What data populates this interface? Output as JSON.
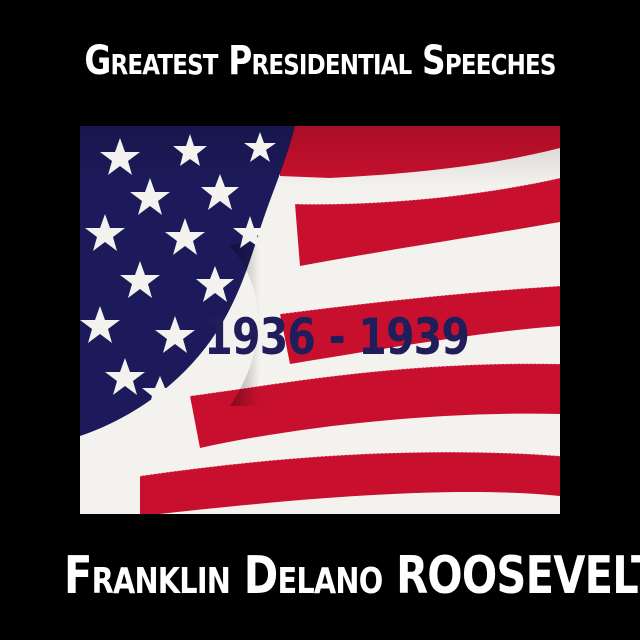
{
  "cover": {
    "top_title": "Greatest Presidential Speeches",
    "years": "1936 - 1939",
    "bottom_title_first": "Franklin Delano",
    "bottom_title_last": "ROOSEVELT"
  },
  "colors": {
    "background": "#000000",
    "text": "#ffffff",
    "years_text": "#1f1e5b",
    "flag_red": "#c8102e",
    "flag_white": "#f4f2ee",
    "flag_blue": "#1c1a5a"
  },
  "icons": {
    "flag": "american-flag-icon",
    "star": "star-icon"
  }
}
